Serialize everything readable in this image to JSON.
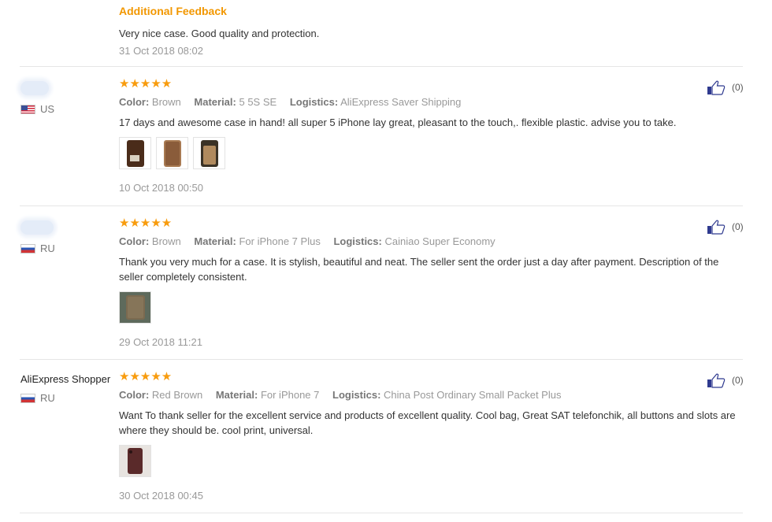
{
  "additional_feedback": {
    "title": "Additional Feedback",
    "text": "Very nice case. Good quality and protection.",
    "date": "31 Oct 2018 08:02"
  },
  "reviews": [
    {
      "user_name": "",
      "country_code": "US",
      "stars": "★★★★★",
      "rating": 5,
      "attributes": [
        {
          "label": "Color:",
          "value": "Brown"
        },
        {
          "label": "Material:",
          "value": "5 5S SE"
        },
        {
          "label": "Logistics:",
          "value": "AliExpress Saver Shipping"
        }
      ],
      "text": "17 days and awesome case in hand! all super 5 iPhone lay great, pleasant to the touch,. flexible plastic. advise you to take.",
      "photo_count": 3,
      "date": "10 Oct 2018 00:50",
      "helpful_count": "(0)"
    },
    {
      "user_name": "",
      "country_code": "RU",
      "stars": "★★★★★",
      "rating": 5,
      "attributes": [
        {
          "label": "Color:",
          "value": "Brown"
        },
        {
          "label": "Material:",
          "value": "For iPhone 7 Plus"
        },
        {
          "label": "Logistics:",
          "value": "Cainiao Super Economy"
        }
      ],
      "text": "Thank you very much for a case. It is stylish, beautiful and neat. The seller sent the order just a day after payment. Description of the seller completely consistent.",
      "photo_count": 1,
      "date": "29 Oct 2018 11:21",
      "helpful_count": "(0)"
    },
    {
      "user_name": "AliExpress Shopper",
      "country_code": "RU",
      "stars": "★★★★★",
      "rating": 5,
      "attributes": [
        {
          "label": "Color:",
          "value": "Red Brown"
        },
        {
          "label": "Material:",
          "value": "For iPhone 7"
        },
        {
          "label": "Logistics:",
          "value": "China Post Ordinary Small Packet Plus"
        }
      ],
      "text": "Want To thank seller for the excellent service and products of excellent quality. Cool bag, Great SAT telefonchik, all buttons and slots are where they should be. cool print, universal.",
      "photo_count": 1,
      "date": "30 Oct 2018 00:45",
      "helpful_count": "(0)"
    }
  ],
  "icons": {
    "like": "thumbs-up-icon",
    "us_flag": "us-flag-icon",
    "ru_flag": "ru-flag-icon",
    "star": "star-icon"
  },
  "colors": {
    "accent_orange": "#f29700",
    "star": "#f89c0e",
    "muted_text": "#999999",
    "divider": "#e6e6e6"
  }
}
